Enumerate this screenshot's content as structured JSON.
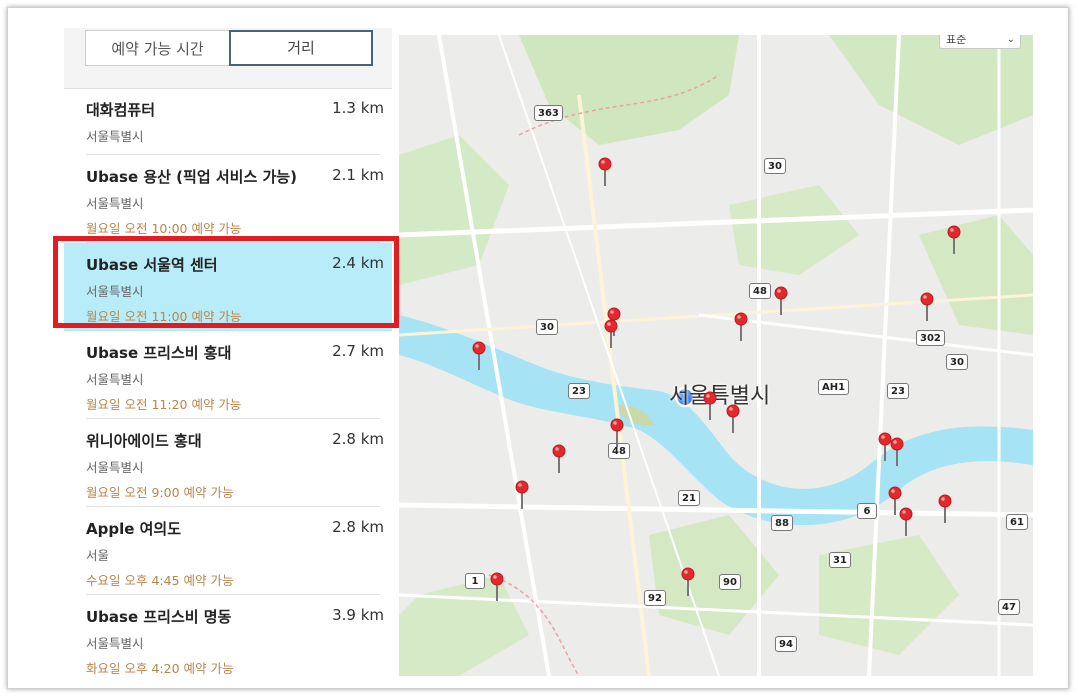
{
  "tabs": [
    {
      "label": "예약 가능 시간"
    },
    {
      "label": "거리"
    }
  ],
  "locations": [
    {
      "name": "대화컴퓨터",
      "distance": "1.3 km",
      "city": "서울특별시",
      "availability": ""
    },
    {
      "name": "Ubase 용산 (픽업 서비스 가능)",
      "distance": "2.1 km",
      "city": "서울특별시",
      "availability": "월요일 오전 10:00 예약 가능"
    },
    {
      "name": "Ubase 서울역 센터",
      "distance": "2.4 km",
      "city": "서울특별시",
      "availability": "월요일 오전 11:00 예약 가능"
    },
    {
      "name": "Ubase 프리스비 홍대",
      "distance": "2.7 km",
      "city": "서울특별시",
      "availability": "월요일 오전 11:20 예약 가능"
    },
    {
      "name": "위니아에이드 홍대",
      "distance": "2.8 km",
      "city": "서울특별시",
      "availability": "월요일 오전 9:00 예약 가능"
    },
    {
      "name": "Apple 여의도",
      "distance": "2.8 km",
      "city": "서울",
      "availability": "수요일 오후 4:45 예약 가능"
    },
    {
      "name": "Ubase 프리스비 명동",
      "distance": "3.9 km",
      "city": "서울특별시",
      "availability": "화요일 오후 4:20 예약 가능"
    }
  ],
  "map": {
    "type_select": "표준",
    "city_label": "서울특별시",
    "road_shields": [
      "363",
      "30",
      "48",
      "30",
      "302",
      "30",
      "23",
      "AH1",
      "23",
      "48",
      "21",
      "6",
      "88",
      "61",
      "31",
      "1",
      "90",
      "92",
      "47",
      "94"
    ]
  },
  "colors": {
    "selected_row": "#b8ecf9",
    "highlight_box": "#e11c22",
    "availability_text": "#b9864b",
    "river": "#a6e3f5",
    "pin": "#e4282c",
    "current_location": "#2f7cf6"
  }
}
